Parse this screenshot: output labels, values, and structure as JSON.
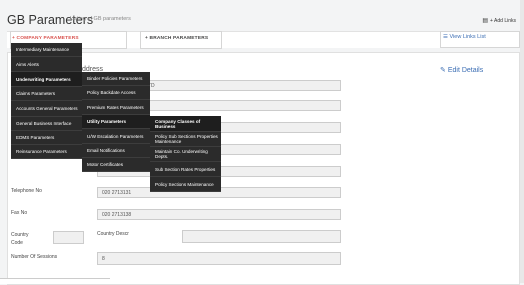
{
  "header": {
    "title": "GB Parameters",
    "subtitle": "Listing of GB parameters",
    "add_links": "+ Add Links"
  },
  "tabs": {
    "company": "+ COMPANY PARAMETERS",
    "branch": "+ BRANCH PARAMETERS",
    "view_links": "View Links List"
  },
  "form": {
    "edit_details": "Edit Details",
    "address_fragment": "ddress",
    "company_name_fragment": "TD",
    "telephone_label": "Telephone No",
    "telephone_value": "020 2713131",
    "fax_label": "Fax No",
    "fax_value": "020 2713138",
    "country_code_label": "Country Code",
    "country_descr_label": "Country Descr",
    "sessions_label": "Number Of Sessions",
    "sessions_value": "8"
  },
  "menu_level1": [
    "Intermediary Maintenance",
    "Aims Alerts",
    "Underwriting Parameters",
    "Claims Parameters",
    "Accounts General Parameters",
    "General Business Interface",
    "EDMS Parameters",
    "Reinsurance Parameters"
  ],
  "menu_level2": [
    "Binder Policies Parameters",
    "Policy Backdate Access",
    "Premium Rates Parameters",
    "Utility Parameters",
    "U/W Escalation Parameters",
    "Email Notifications",
    "Motor Certificates"
  ],
  "menu_level3": [
    "Company Classes of Business",
    "Policy Sub Sections Properties Maintenance",
    "Maintain Co. Underwriting Depts.",
    "Sub Section Rates Properties",
    "Policy Sections Maintenance"
  ]
}
